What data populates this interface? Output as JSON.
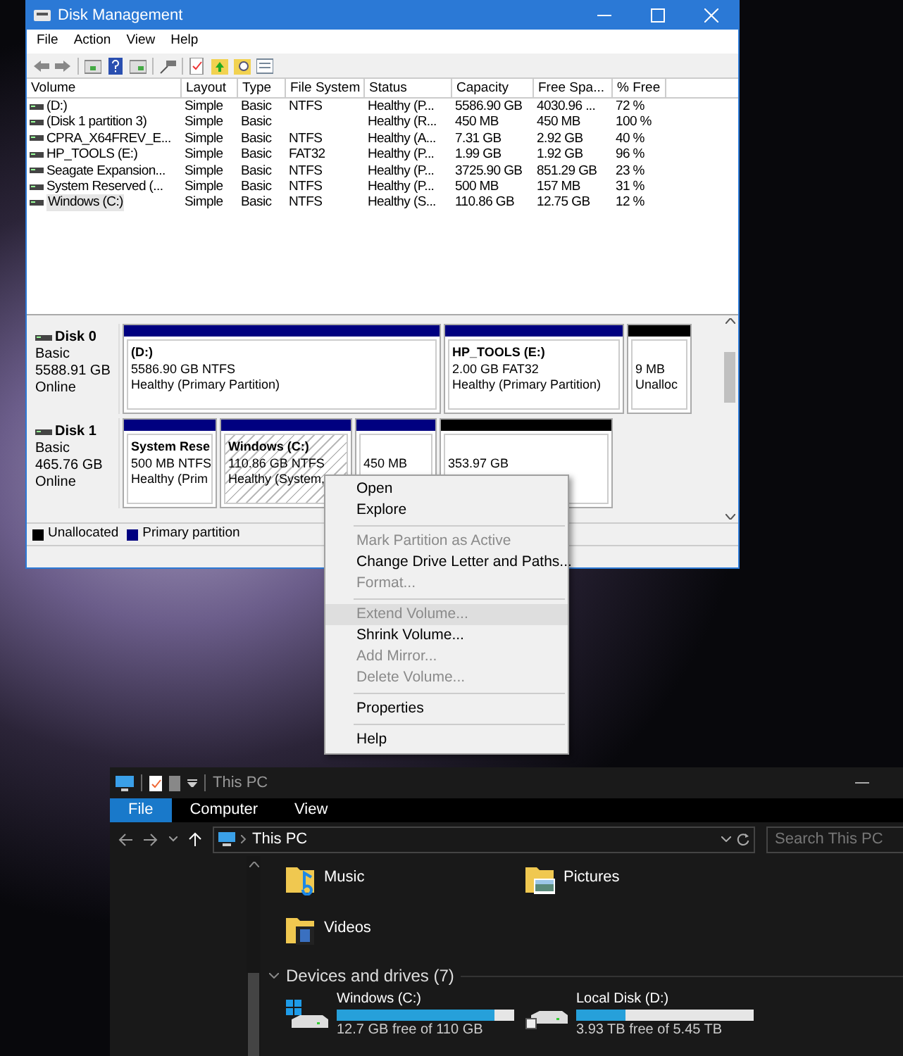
{
  "disk_management": {
    "title": "Disk Management",
    "menu": [
      "File",
      "Action",
      "View",
      "Help"
    ],
    "table": {
      "columns": [
        "Volume",
        "Layout",
        "Type",
        "File System",
        "Status",
        "Capacity",
        "Free Spa...",
        "% Free"
      ],
      "rows": [
        {
          "cells": [
            "(D:)",
            "Simple",
            "Basic",
            "NTFS",
            "Healthy (P...",
            "5586.90 GB",
            "4030.96 ...",
            "72 %"
          ],
          "selected": false
        },
        {
          "cells": [
            "(Disk 1 partition 3)",
            "Simple",
            "Basic",
            "",
            "Healthy (R...",
            "450 MB",
            "450 MB",
            "100 %"
          ],
          "selected": false
        },
        {
          "cells": [
            "CPRA_X64FREV_E...",
            "Simple",
            "Basic",
            "NTFS",
            "Healthy (A...",
            "7.31 GB",
            "2.92 GB",
            "40 %"
          ],
          "selected": false
        },
        {
          "cells": [
            "HP_TOOLS (E:)",
            "Simple",
            "Basic",
            "FAT32",
            "Healthy (P...",
            "1.99 GB",
            "1.92 GB",
            "96 %"
          ],
          "selected": false
        },
        {
          "cells": [
            "Seagate Expansion...",
            "Simple",
            "Basic",
            "NTFS",
            "Healthy (P...",
            "3725.90 GB",
            "851.29 GB",
            "23 %"
          ],
          "selected": false
        },
        {
          "cells": [
            "System Reserved (...",
            "Simple",
            "Basic",
            "NTFS",
            "Healthy (P...",
            "500 MB",
            "157 MB",
            "31 %"
          ],
          "selected": false
        },
        {
          "cells": [
            "Windows (C:)",
            "Simple",
            "Basic",
            "NTFS",
            "Healthy (S...",
            "110.86 GB",
            "12.75 GB",
            "12 %"
          ],
          "selected": true
        }
      ]
    },
    "disks": [
      {
        "name": "Disk 0",
        "type": "Basic",
        "size": "5588.91 GB",
        "status": "Online",
        "partitions": [
          {
            "kind": "primary",
            "label": "(D:)",
            "size": "5586.90 GB NTFS",
            "status": "Healthy (Primary Partition)",
            "selected": false
          },
          {
            "kind": "primary",
            "label": "HP_TOOLS  (E:)",
            "size": "2.00 GB FAT32",
            "status": "Healthy (Primary Partition)",
            "selected": false
          },
          {
            "kind": "unallocated",
            "size": "9 MB",
            "status": "Unalloc",
            "selected": false
          }
        ]
      },
      {
        "name": "Disk 1",
        "type": "Basic",
        "size": "465.76 GB",
        "status": "Online",
        "partitions": [
          {
            "kind": "primary",
            "label": "System Rese",
            "size": "500 MB NTFS",
            "status": "Healthy (Prim",
            "selected": false
          },
          {
            "kind": "primary",
            "label": "Windows  (C:)",
            "size": "110.86 GB NTFS",
            "status": "Healthy (System,",
            "selected": true
          },
          {
            "kind": "primary",
            "size": "450 MB",
            "selected": false
          },
          {
            "kind": "unallocated",
            "size": "353.97 GB",
            "selected": false
          }
        ]
      }
    ],
    "legend": [
      {
        "kind": "unallocated",
        "label": "Unallocated"
      },
      {
        "kind": "primary",
        "label": "Primary partition"
      }
    ]
  },
  "context_menu": {
    "groups": [
      [
        {
          "label": "Open",
          "disabled": false,
          "selected": false
        },
        {
          "label": "Explore",
          "disabled": false,
          "selected": false
        }
      ],
      [
        {
          "label": "Mark Partition as Active",
          "disabled": true,
          "selected": false
        },
        {
          "label": "Change Drive Letter and Paths...",
          "disabled": false,
          "selected": false
        },
        {
          "label": "Format...",
          "disabled": true,
          "selected": false
        }
      ],
      [
        {
          "label": "Extend Volume...",
          "disabled": true,
          "selected": true
        },
        {
          "label": "Shrink Volume...",
          "disabled": false,
          "selected": false
        },
        {
          "label": "Add Mirror...",
          "disabled": true,
          "selected": false
        },
        {
          "label": "Delete Volume...",
          "disabled": true,
          "selected": false
        }
      ],
      [
        {
          "label": "Properties",
          "disabled": false,
          "selected": false
        }
      ],
      [
        {
          "label": "Help",
          "disabled": false,
          "selected": false
        }
      ]
    ]
  },
  "explorer": {
    "title": "This PC",
    "ribbon_tabs": [
      {
        "label": "File",
        "selected": true
      },
      {
        "label": "Computer",
        "selected": false
      },
      {
        "label": "View",
        "selected": false
      }
    ],
    "address": "This PC",
    "search": {
      "placeholder": "Search This PC"
    },
    "folders": [
      {
        "kind": "music",
        "name": "Music"
      },
      {
        "kind": "pictures",
        "name": "Pictures"
      },
      {
        "kind": "videos",
        "name": "Videos"
      }
    ],
    "section": "Devices and drives (7)",
    "drives": [
      {
        "kind": "windows",
        "name": "Windows (C:)",
        "level": 0.89,
        "free": "12.7 GB free of 110 GB"
      },
      {
        "kind": "disk",
        "name": "Local Disk (D:)",
        "level": 0.28,
        "free": "3.93 TB free of 5.45 TB"
      }
    ]
  }
}
